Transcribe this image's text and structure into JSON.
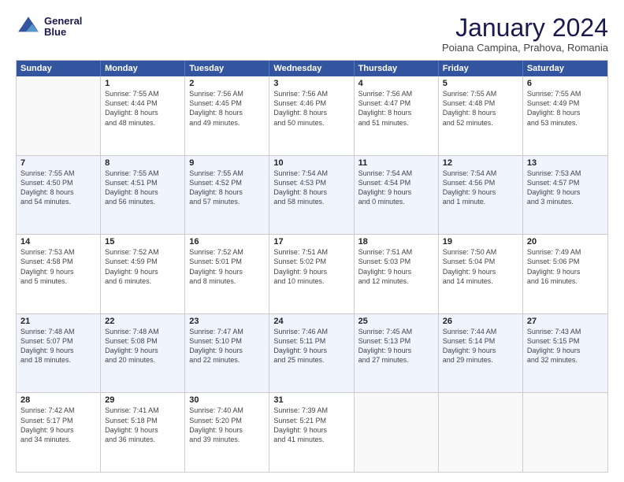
{
  "header": {
    "logo": {
      "line1": "General",
      "line2": "Blue"
    },
    "title": "January 2024",
    "subtitle": "Poiana Campina, Prahova, Romania"
  },
  "days_of_week": [
    "Sunday",
    "Monday",
    "Tuesday",
    "Wednesday",
    "Thursday",
    "Friday",
    "Saturday"
  ],
  "rows": [
    [
      {
        "day": "",
        "info": ""
      },
      {
        "day": "1",
        "info": "Sunrise: 7:55 AM\nSunset: 4:44 PM\nDaylight: 8 hours\nand 48 minutes."
      },
      {
        "day": "2",
        "info": "Sunrise: 7:56 AM\nSunset: 4:45 PM\nDaylight: 8 hours\nand 49 minutes."
      },
      {
        "day": "3",
        "info": "Sunrise: 7:56 AM\nSunset: 4:46 PM\nDaylight: 8 hours\nand 50 minutes."
      },
      {
        "day": "4",
        "info": "Sunrise: 7:56 AM\nSunset: 4:47 PM\nDaylight: 8 hours\nand 51 minutes."
      },
      {
        "day": "5",
        "info": "Sunrise: 7:55 AM\nSunset: 4:48 PM\nDaylight: 8 hours\nand 52 minutes."
      },
      {
        "day": "6",
        "info": "Sunrise: 7:55 AM\nSunset: 4:49 PM\nDaylight: 8 hours\nand 53 minutes."
      }
    ],
    [
      {
        "day": "7",
        "info": "Sunrise: 7:55 AM\nSunset: 4:50 PM\nDaylight: 8 hours\nand 54 minutes."
      },
      {
        "day": "8",
        "info": "Sunrise: 7:55 AM\nSunset: 4:51 PM\nDaylight: 8 hours\nand 56 minutes."
      },
      {
        "day": "9",
        "info": "Sunrise: 7:55 AM\nSunset: 4:52 PM\nDaylight: 8 hours\nand 57 minutes."
      },
      {
        "day": "10",
        "info": "Sunrise: 7:54 AM\nSunset: 4:53 PM\nDaylight: 8 hours\nand 58 minutes."
      },
      {
        "day": "11",
        "info": "Sunrise: 7:54 AM\nSunset: 4:54 PM\nDaylight: 9 hours\nand 0 minutes."
      },
      {
        "day": "12",
        "info": "Sunrise: 7:54 AM\nSunset: 4:56 PM\nDaylight: 9 hours\nand 1 minute."
      },
      {
        "day": "13",
        "info": "Sunrise: 7:53 AM\nSunset: 4:57 PM\nDaylight: 9 hours\nand 3 minutes."
      }
    ],
    [
      {
        "day": "14",
        "info": "Sunrise: 7:53 AM\nSunset: 4:58 PM\nDaylight: 9 hours\nand 5 minutes."
      },
      {
        "day": "15",
        "info": "Sunrise: 7:52 AM\nSunset: 4:59 PM\nDaylight: 9 hours\nand 6 minutes."
      },
      {
        "day": "16",
        "info": "Sunrise: 7:52 AM\nSunset: 5:01 PM\nDaylight: 9 hours\nand 8 minutes."
      },
      {
        "day": "17",
        "info": "Sunrise: 7:51 AM\nSunset: 5:02 PM\nDaylight: 9 hours\nand 10 minutes."
      },
      {
        "day": "18",
        "info": "Sunrise: 7:51 AM\nSunset: 5:03 PM\nDaylight: 9 hours\nand 12 minutes."
      },
      {
        "day": "19",
        "info": "Sunrise: 7:50 AM\nSunset: 5:04 PM\nDaylight: 9 hours\nand 14 minutes."
      },
      {
        "day": "20",
        "info": "Sunrise: 7:49 AM\nSunset: 5:06 PM\nDaylight: 9 hours\nand 16 minutes."
      }
    ],
    [
      {
        "day": "21",
        "info": "Sunrise: 7:48 AM\nSunset: 5:07 PM\nDaylight: 9 hours\nand 18 minutes."
      },
      {
        "day": "22",
        "info": "Sunrise: 7:48 AM\nSunset: 5:08 PM\nDaylight: 9 hours\nand 20 minutes."
      },
      {
        "day": "23",
        "info": "Sunrise: 7:47 AM\nSunset: 5:10 PM\nDaylight: 9 hours\nand 22 minutes."
      },
      {
        "day": "24",
        "info": "Sunrise: 7:46 AM\nSunset: 5:11 PM\nDaylight: 9 hours\nand 25 minutes."
      },
      {
        "day": "25",
        "info": "Sunrise: 7:45 AM\nSunset: 5:13 PM\nDaylight: 9 hours\nand 27 minutes."
      },
      {
        "day": "26",
        "info": "Sunrise: 7:44 AM\nSunset: 5:14 PM\nDaylight: 9 hours\nand 29 minutes."
      },
      {
        "day": "27",
        "info": "Sunrise: 7:43 AM\nSunset: 5:15 PM\nDaylight: 9 hours\nand 32 minutes."
      }
    ],
    [
      {
        "day": "28",
        "info": "Sunrise: 7:42 AM\nSunset: 5:17 PM\nDaylight: 9 hours\nand 34 minutes."
      },
      {
        "day": "29",
        "info": "Sunrise: 7:41 AM\nSunset: 5:18 PM\nDaylight: 9 hours\nand 36 minutes."
      },
      {
        "day": "30",
        "info": "Sunrise: 7:40 AM\nSunset: 5:20 PM\nDaylight: 9 hours\nand 39 minutes."
      },
      {
        "day": "31",
        "info": "Sunrise: 7:39 AM\nSunset: 5:21 PM\nDaylight: 9 hours\nand 41 minutes."
      },
      {
        "day": "",
        "info": ""
      },
      {
        "day": "",
        "info": ""
      },
      {
        "day": "",
        "info": ""
      }
    ]
  ]
}
